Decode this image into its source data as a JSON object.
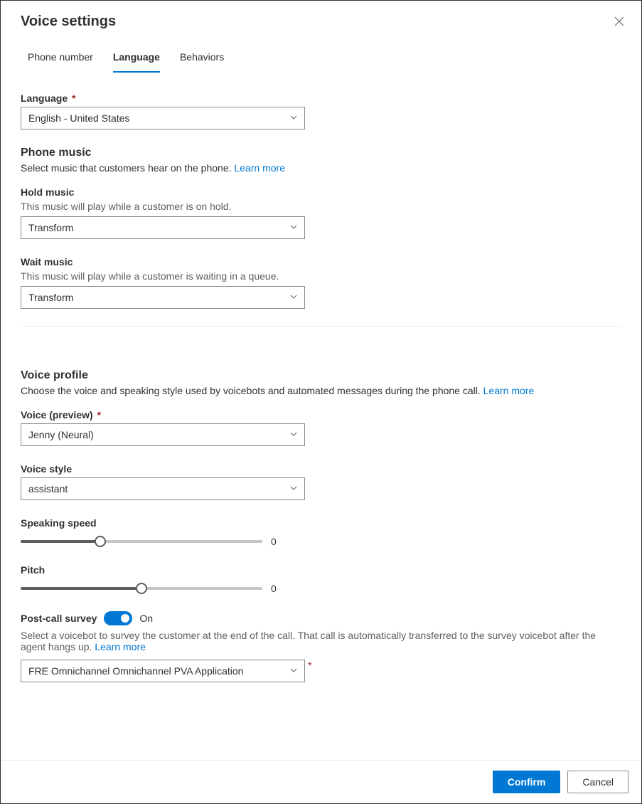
{
  "header": {
    "title": "Voice settings"
  },
  "tabs": {
    "phone": "Phone number",
    "language": "Language",
    "behaviors": "Behaviors",
    "active": "language"
  },
  "language_section": {
    "label": "Language",
    "required_marker": "*",
    "value": "English - United States"
  },
  "phone_music": {
    "heading": "Phone music",
    "description": "Select music that customers hear on the phone. ",
    "learn_more": "Learn more",
    "hold": {
      "label": "Hold music",
      "helper": "This music will play while a customer is on hold.",
      "value": "Transform"
    },
    "wait": {
      "label": "Wait music",
      "helper": "This music will play while a customer is waiting in a queue.",
      "value": "Transform"
    }
  },
  "voice_profile": {
    "heading": "Voice profile",
    "description": "Choose the voice and speaking style used by voicebots and automated messages during the phone call. ",
    "learn_more": "Learn more",
    "voice": {
      "label": "Voice (preview)",
      "required_marker": "*",
      "value": "Jenny (Neural)"
    },
    "style": {
      "label": "Voice style",
      "value": "assistant"
    },
    "speed": {
      "label": "Speaking speed",
      "value": "0",
      "percent": 33
    },
    "pitch": {
      "label": "Pitch",
      "value": "0",
      "percent": 50
    }
  },
  "survey": {
    "label": "Post-call survey",
    "state": "On",
    "description": "Select a voicebot to survey the customer at the end of the call. That call is automatically transferred to the survey voicebot after the agent hangs up. ",
    "learn_more": "Learn more",
    "value": "FRE Omnichannel Omnichannel PVA Application",
    "required_marker": "*"
  },
  "footer": {
    "confirm": "Confirm",
    "cancel": "Cancel"
  }
}
